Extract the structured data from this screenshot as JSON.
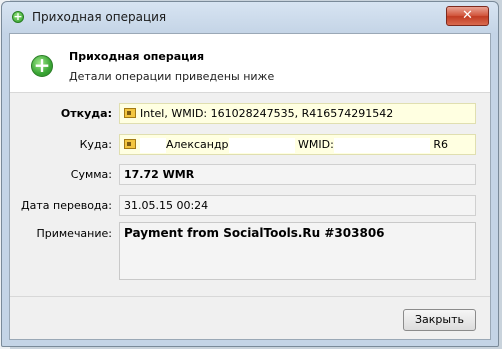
{
  "window": {
    "title": "Приходная операция"
  },
  "header": {
    "title": "Приходная операция",
    "subtitle": "Детали операции приведены ниже"
  },
  "fields": {
    "from_label": "Откуда:",
    "from_value": "Intel, WMID: 161028247535, R416574291542",
    "to_label": "Куда:",
    "to_name": "Александр",
    "to_wmid_label": "WMID:",
    "to_partial": "R6",
    "amount_label": "Сумма:",
    "amount_value": "17.72 WMR",
    "date_label": "Дата перевода:",
    "date_value": "31.05.15 00:24",
    "note_label": "Примечание:",
    "note_value": "Payment from SocialTools.Ru #303806"
  },
  "footer": {
    "close_label": "Закрыть"
  },
  "icons": {
    "title": "green-plus-icon",
    "header": "green-plus-icon",
    "wallet": "wm-passport-icon",
    "close": "close-x-icon"
  },
  "colors": {
    "highlight_field": "#ffffe1",
    "close_button": "#c13b22",
    "plus_icon": "#3aa535"
  }
}
